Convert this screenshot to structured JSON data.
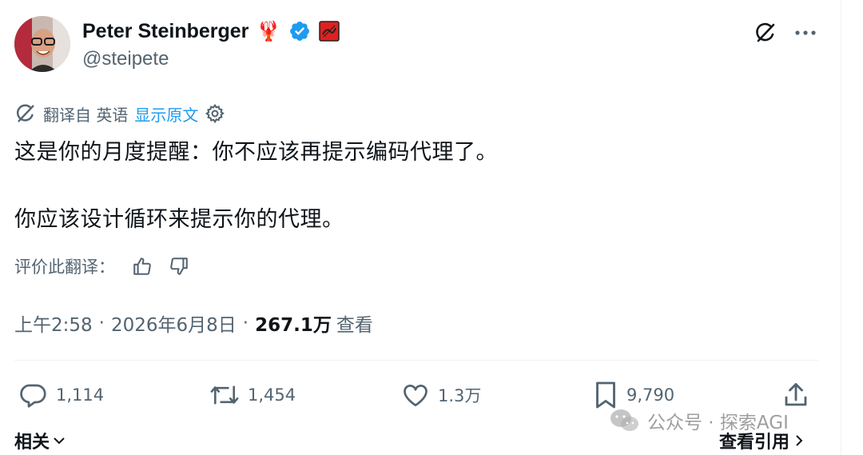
{
  "author": {
    "display_name": "Peter Steinberger",
    "handle": "@steipete",
    "emoji": "🦞"
  },
  "icons": {
    "avatar": "avatar",
    "verified": "verified-badge-icon",
    "affiliate": "affiliate-badge-icon",
    "grok": "grok-icon",
    "more": "more-horizontal-icon",
    "settings": "gear-icon",
    "thumbs_up": "thumbs-up-icon",
    "thumbs_down": "thumbs-down-icon",
    "reply": "reply-icon",
    "repost": "repost-icon",
    "like": "heart-icon",
    "bookmark": "bookmark-icon",
    "share": "share-icon",
    "wechat": "wechat-icon"
  },
  "translation": {
    "label": "翻译自 英语",
    "show_original": "显示原文"
  },
  "tweet": {
    "line1": "这是你的月度提醒：你不应该再提示编码代理了。",
    "line2": "你应该设计循环来提示你的代理。"
  },
  "rate": {
    "label": "评价此翻译："
  },
  "meta": {
    "time": "上午2:58",
    "date": "2026年6月8日",
    "views_count": "267.1万",
    "views_label": "查看",
    "separator": "·"
  },
  "actions": {
    "replies": "1,114",
    "reposts": "1,454",
    "likes": "1.3万",
    "bookmarks": "9,790"
  },
  "footer": {
    "related": "相关",
    "view_quotes": "查看引用"
  },
  "watermark": {
    "text": "公众号 · 探索AGI"
  },
  "colors": {
    "accent": "#1d9bf0",
    "text_primary": "#0f1419",
    "text_secondary": "#536471",
    "divider": "#eff3f4"
  }
}
